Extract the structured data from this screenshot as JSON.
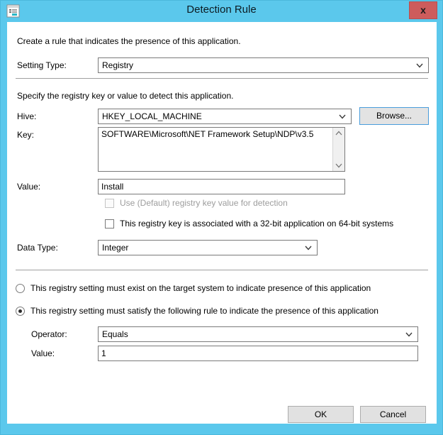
{
  "window": {
    "title": "Detection Rule",
    "icon": "form-window-icon",
    "close_label": "x",
    "frame_color": "#5bc8ec",
    "close_color": "#cd5c5c"
  },
  "intro": {
    "line1": "Create a rule that indicates the presence of this application.",
    "line2": "Specify the registry key or value to detect this application."
  },
  "setting_type": {
    "label": "Setting Type:",
    "value": "Registry"
  },
  "hive": {
    "label": "Hive:",
    "value": "HKEY_LOCAL_MACHINE",
    "browse_label": "Browse..."
  },
  "key": {
    "label": "Key:",
    "value": "SOFTWARE\\Microsoft\\NET Framework Setup\\NDP\\v3.5"
  },
  "value_field": {
    "label": "Value:",
    "value": "Install"
  },
  "checkboxes": [
    {
      "label": "Use (Default) registry key value for detection",
      "checked": false,
      "disabled": true
    },
    {
      "label": "This registry key is associated with a 32-bit application on 64-bit systems",
      "checked": false,
      "disabled": false
    }
  ],
  "data_type": {
    "label": "Data Type:",
    "value": "Integer"
  },
  "radios": [
    {
      "label": "This registry setting must exist on the target system to indicate presence of this application",
      "selected": false
    },
    {
      "label": "This registry setting must satisfy the following rule to indicate the presence of this application",
      "selected": true
    }
  ],
  "operator": {
    "label": "Operator:",
    "value": "Equals"
  },
  "rule_value": {
    "label": "Value:",
    "value": "1"
  },
  "footer": {
    "ok_label": "OK",
    "cancel_label": "Cancel"
  }
}
